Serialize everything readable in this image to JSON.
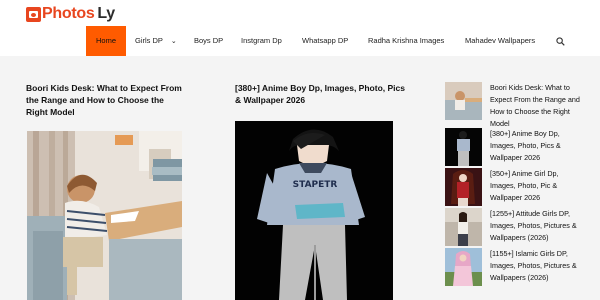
{
  "site": {
    "logo_part1": "Photos",
    "logo_part2": "Ly"
  },
  "nav": {
    "home": "Home",
    "girls_dp": "Girls DP",
    "boys_dp": "Boys DP",
    "instagram_dp": "Instgram Dp",
    "whatsapp_dp": "Whatsapp DP",
    "radha_krishna": "Radha Krishna Images",
    "mahadev": "Mahadev Wallpapers"
  },
  "posts": [
    {
      "title": "Boori Kids Desk: What to Expect From the Range and How to Choose the Right Model",
      "image": "child-drawing-at-desk"
    },
    {
      "title": "[380+] Anime Boy Dp, Images, Photo, Pics & Wallpaper 2026",
      "image": "anime-boy-on-black",
      "shirt_text": "STAPETR"
    }
  ],
  "sidebar": [
    {
      "title": "Boori Kids Desk: What to Expect From the Range and How to Choose the Right Model"
    },
    {
      "title": "[380+] Anime Boy Dp, Images, Photo, Pics & Wallpaper 2026"
    },
    {
      "title": "[350+] Anime Girl Dp, Images, Photo, Pic & Wallpaper 2026"
    },
    {
      "title": "[1255+] Attitude Girls DP, Images, Photos, Pictures & Wallpapers (2026)"
    },
    {
      "title": "[1155+] Islamic Girls DP, Images, Photos, Pictures & Wallpapers (2026)"
    }
  ],
  "colors": {
    "accent": "#ff5b00",
    "logo": "#e8461f"
  },
  "icons": {
    "search": "search-icon",
    "dropdown": "chevron-down-icon",
    "logo": "camera-icon"
  }
}
